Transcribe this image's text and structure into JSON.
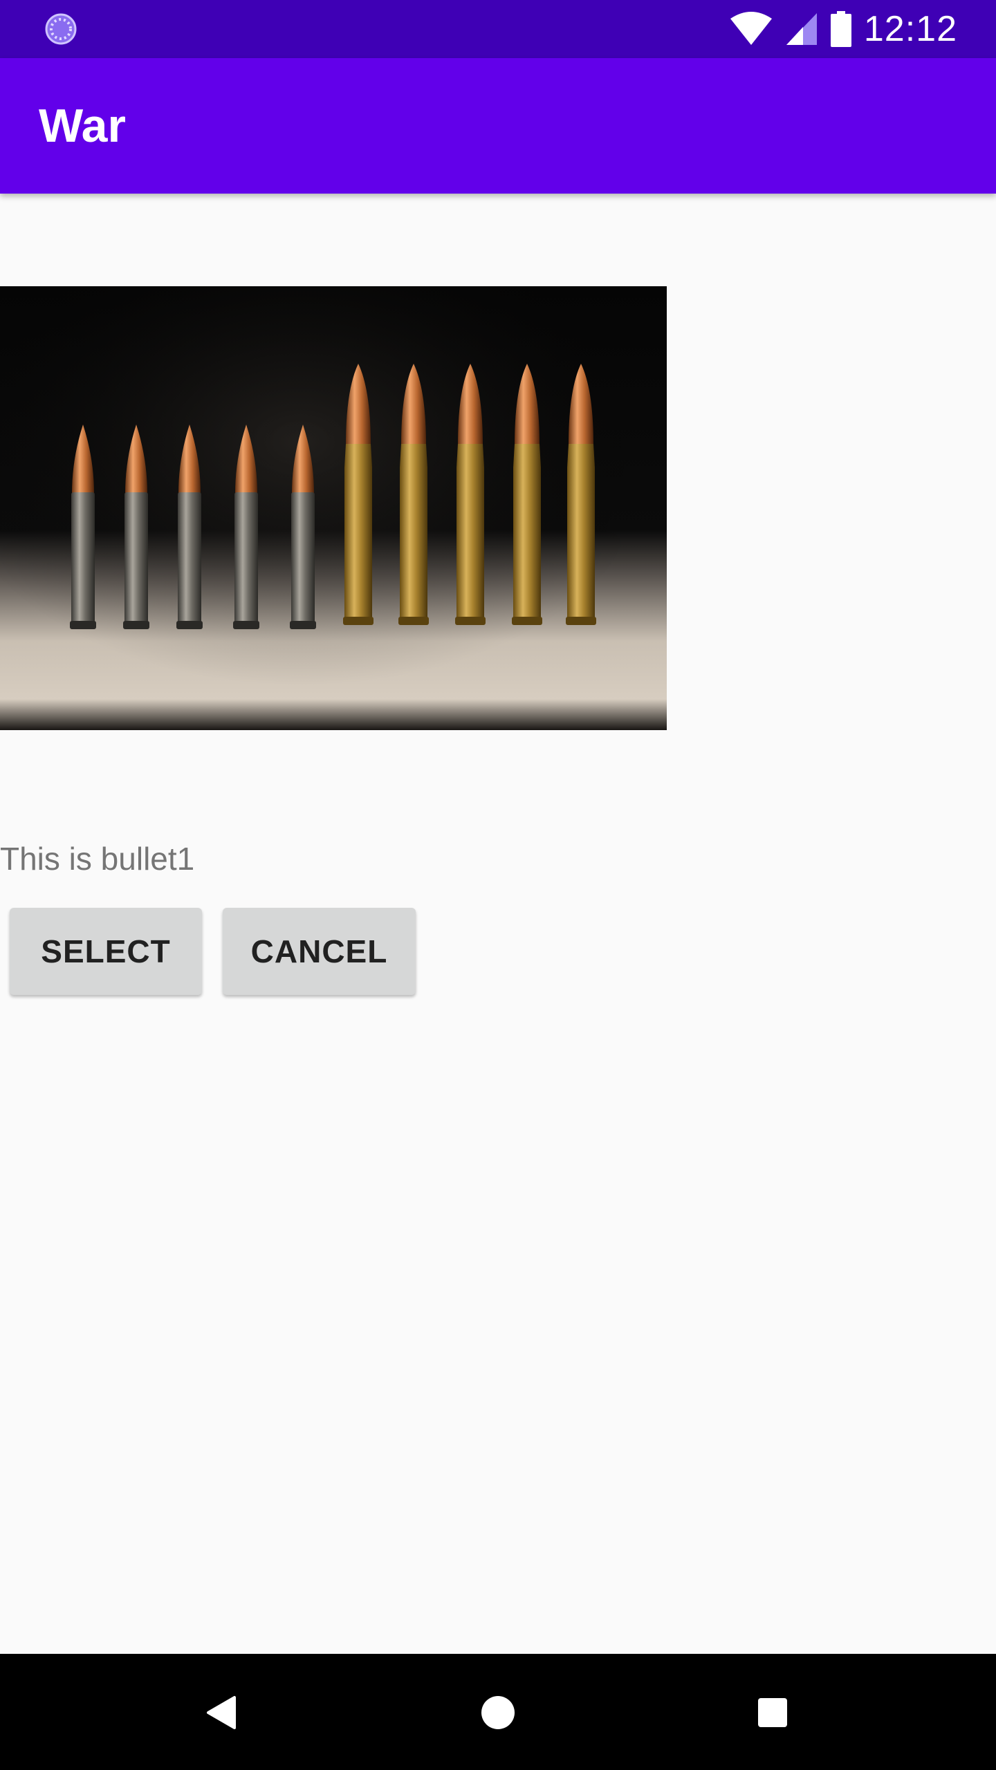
{
  "status_bar": {
    "time": "12:12",
    "left_icon": "sync-progress-icon",
    "icons": [
      "wifi-icon",
      "cell-signal-icon",
      "battery-icon"
    ]
  },
  "app_bar": {
    "title": "War",
    "color": "#6200ea"
  },
  "content": {
    "image_subject": "row of rifle bullets",
    "caption": "This is bullet1"
  },
  "buttons": {
    "select_label": "SELECT",
    "cancel_label": "CANCEL"
  },
  "nav_bar": {
    "icons": [
      "back-icon",
      "home-icon",
      "recents-icon"
    ]
  },
  "colors": {
    "status_bar": "#3f00b5",
    "app_bar": "#6200ea",
    "background": "#fafafa",
    "button": "#d6d7d7"
  }
}
